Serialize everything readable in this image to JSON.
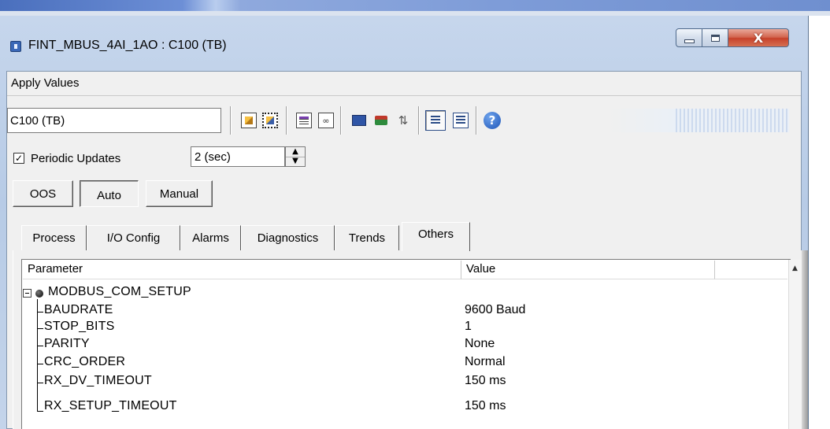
{
  "window": {
    "title": "FINT_MBUS_4AI_1AO : C100 (TB)",
    "close_glyph": "X"
  },
  "menu": {
    "apply_values": "Apply Values"
  },
  "toolbar": {
    "block_field_value": "C100 (TB)"
  },
  "periodic": {
    "checked": true,
    "check_glyph": "✓",
    "label": "Periodic Updates",
    "interval_value": "2 (sec)"
  },
  "modes": {
    "oos": "OOS",
    "auto": "Auto",
    "manual": "Manual"
  },
  "tabs": [
    {
      "label": "Process"
    },
    {
      "label": "I/O Config"
    },
    {
      "label": "Alarms"
    },
    {
      "label": "Diagnostics"
    },
    {
      "label": "Trends"
    },
    {
      "label": "Others",
      "active": true
    }
  ],
  "table": {
    "headers": {
      "parameter": "Parameter",
      "value": "Value"
    },
    "group": "MODBUS_COM_SETUP",
    "rows": [
      {
        "parameter": "BAUDRATE",
        "value": "9600 Baud"
      },
      {
        "parameter": "STOP_BITS",
        "value": "1"
      },
      {
        "parameter": "PARITY",
        "value": "None"
      },
      {
        "parameter": "CRC_ORDER",
        "value": "Normal"
      },
      {
        "parameter": "RX_DV_TIMEOUT",
        "value": "150 ms"
      },
      {
        "parameter": "RX_SETUP_TIMEOUT",
        "value": "150 ms"
      }
    ]
  },
  "icons": {
    "toolbar": [
      "edit-parameters-icon",
      "edit-selected-icon",
      "documents-icon",
      "glasses-view-icon",
      "monitor-icon",
      "transfer-icon",
      "arrows-icon",
      "list-view-icon",
      "detail-view-icon",
      "help-icon"
    ]
  },
  "colors": {
    "title_bar": "#b7cbe6",
    "close_button": "#c6412a",
    "window_background": "#f0f0f0"
  }
}
